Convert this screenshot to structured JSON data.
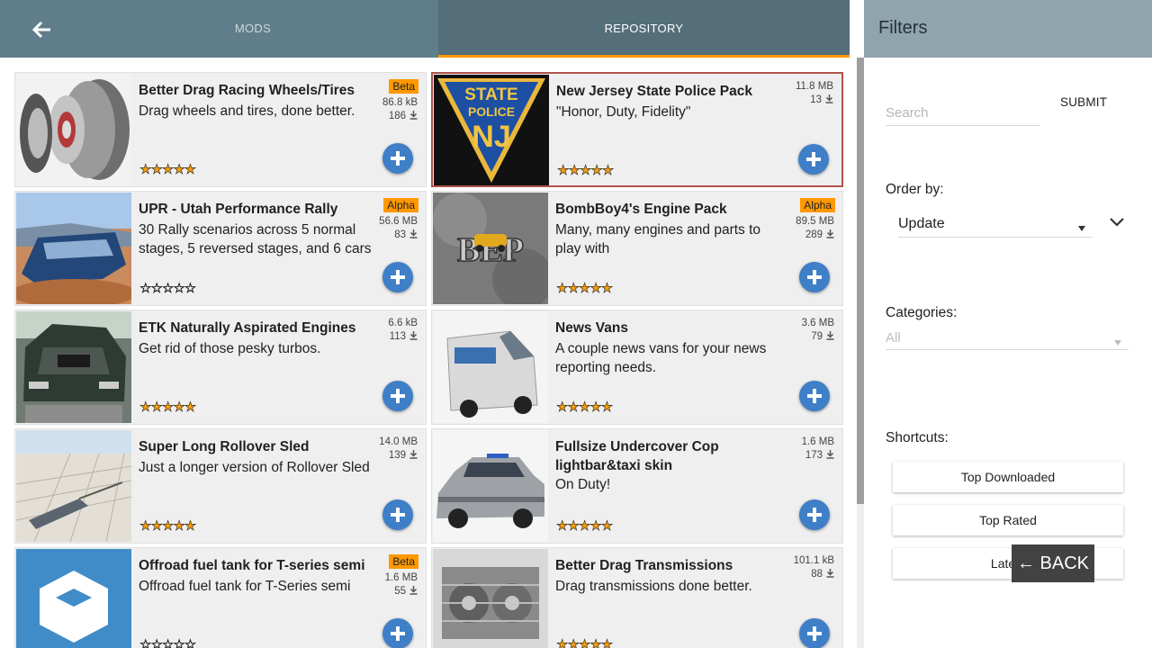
{
  "header": {
    "tabs": [
      {
        "label": "MODS"
      },
      {
        "label": "REPOSITORY"
      }
    ],
    "filters_title": "Filters"
  },
  "mods": [
    {
      "title": "Better Drag Racing Wheels/Tires",
      "description": "Drag wheels and tires, done better.",
      "badge": "Beta",
      "size": "86.8 kB",
      "downloads": "186",
      "rating": 5
    },
    {
      "title": "New Jersey State Police Pack",
      "description": "\"Honor, Duty, Fidelity\"",
      "badge": "",
      "size": "11.8 MB",
      "downloads": "13",
      "rating": 5
    },
    {
      "title": "UPR - Utah Performance Rally",
      "description": "30 Rally scenarios across 5 normal stages, 5 reversed stages, and 6 cars",
      "badge": "Alpha",
      "size": "56.6 MB",
      "downloads": "83",
      "rating": 0
    },
    {
      "title": "BombBoy4's Engine Pack",
      "description": "Many, many engines and parts to play with",
      "badge": "Alpha",
      "size": "89.5 MB",
      "downloads": "289",
      "rating": 5
    },
    {
      "title": "ETK Naturally Aspirated Engines",
      "description": "Get rid of those pesky turbos.",
      "badge": "",
      "size": "6.6 kB",
      "downloads": "113",
      "rating": 5
    },
    {
      "title": "News Vans",
      "description": "A couple news vans for your news reporting needs.",
      "badge": "",
      "size": "3.6 MB",
      "downloads": "79",
      "rating": 5
    },
    {
      "title": "Super Long Rollover Sled",
      "description": "Just a longer version of Rollover Sled",
      "badge": "",
      "size": "14.0 MB",
      "downloads": "139",
      "rating": 5
    },
    {
      "title": "Fullsize Undercover Cop lightbar&taxi skin",
      "description": "On Duty!",
      "badge": "",
      "size": "1.6 MB",
      "downloads": "173",
      "rating": 5
    },
    {
      "title": "Offroad fuel tank for T-series semi",
      "description": "Offroad fuel tank for T-Series semi",
      "badge": "Beta",
      "size": "1.6 MB",
      "downloads": "55",
      "rating": 0
    },
    {
      "title": "Better Drag Transmissions",
      "description": "Drag transmissions done better.",
      "badge": "",
      "size": "101.1 kB",
      "downloads": "88",
      "rating": 5
    }
  ],
  "stars": {
    "full": "★★★★★",
    "empty": "☆☆☆☆☆"
  },
  "thumbnail_text": {
    "state": "STATE",
    "police": "POLICE",
    "nj": "NJ",
    "bep": "BEP"
  },
  "filters": {
    "search_placeholder": "Search",
    "submit_label": "SUBMIT",
    "order_label": "Order by:",
    "order_value": "Update",
    "categories_label": "Categories:",
    "categories_value": "All",
    "shortcuts_label": "Shortcuts:",
    "shortcuts": [
      {
        "label": "Top Downloaded"
      },
      {
        "label": "Top Rated"
      },
      {
        "label": "Latest"
      }
    ]
  },
  "back_button": "← BACK",
  "colors": {
    "header": "#607d8b",
    "tab_indicator": "#ff9800",
    "badge": "#ff9800",
    "add_button": "#3f7fc7"
  }
}
